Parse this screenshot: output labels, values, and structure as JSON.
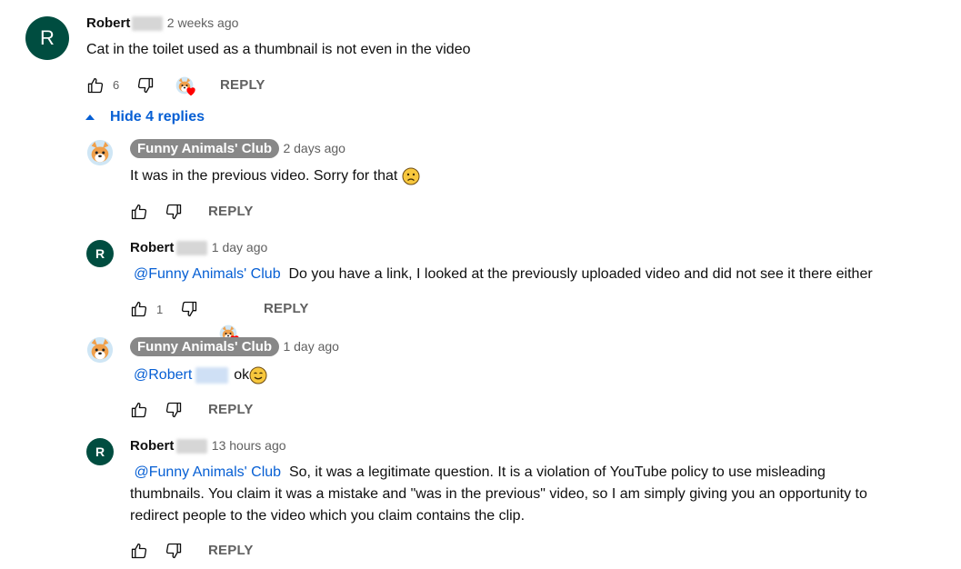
{
  "comment": {
    "author": "Robert",
    "time": "2 weeks ago",
    "avatar_letter": "R",
    "text": "Cat in the toilet used as a thumbnail is not even in the video",
    "likes": "6",
    "reply_label": "REPLY"
  },
  "toggle": {
    "label": "Hide 4 replies"
  },
  "replies": [
    {
      "author": "Funny Animals' Club",
      "time": "2 days ago",
      "text": "It was in the previous video. Sorry for that",
      "emoji": "frowning-face",
      "reply_label": "REPLY"
    },
    {
      "author": "Robert",
      "avatar_letter": "R",
      "time": "1 day ago",
      "mention": "@Funny Animals' Club",
      "text": "Do you have a link, I looked at the previously uploaded video and did not see it there either",
      "likes": "1",
      "reply_label": "REPLY"
    },
    {
      "author": "Funny Animals' Club",
      "time": "1 day ago",
      "mention": "@Robert",
      "text": "ok",
      "emoji": "smiling-face",
      "reply_label": "REPLY"
    },
    {
      "author": "Robert",
      "avatar_letter": "R",
      "time": "13 hours ago",
      "mention": "@Funny Animals' Club",
      "text_lines": [
        "So, it was a legitimate question. It is a violation of YouTube policy to use misleading",
        "thumbnails. You claim it was a mistake and \"was in the previous\" video, so I am simply giving you an opportunity to",
        "redirect people to the video which you claim contains the clip."
      ],
      "reply_label": "REPLY"
    }
  ],
  "colors": {
    "avatar_bg": "#004d40",
    "link": "#065fd4",
    "chip_bg": "#888888",
    "heart": "#ff0000",
    "secondary_text": "#606060"
  },
  "icons": [
    "thumb-up-icon",
    "thumb-down-icon",
    "creator-heart-icon",
    "caret-up-icon",
    "dog-avatar-icon"
  ]
}
